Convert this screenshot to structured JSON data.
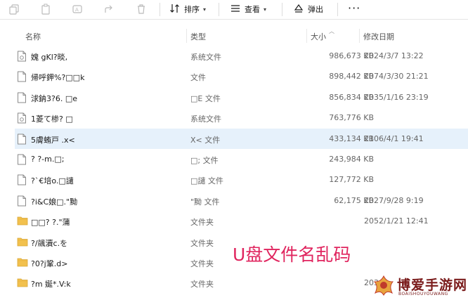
{
  "toolbar": {
    "sort_label": "排序",
    "view_label": "查看",
    "eject_label": "弹出",
    "more_label": "···"
  },
  "columns": {
    "name": "名称",
    "type": "类型",
    "size": "大小",
    "date": "修改日期"
  },
  "rows": [
    {
      "kind": "file",
      "name": "媿  gKl?晱,",
      "type": "系统文件",
      "size": "986,673 KB",
      "date": "2024/3/7 13:22"
    },
    {
      "kind": "file",
      "name": "帰呼鉀%?□□k",
      "type": "文件",
      "size": "898,442 KB",
      "date": "2074/3/30 21:21"
    },
    {
      "kind": "file",
      "name": "浗鈉3?6. □e",
      "type": "□E 文件",
      "size": "856,834 KB",
      "date": "2035/1/16 23:19"
    },
    {
      "kind": "file",
      "name": "1菱て椮?   □",
      "type": "系统文件",
      "size": "763,776 KB",
      "date": ""
    },
    {
      "kind": "file",
      "name": "5膚蛕戸 .x<",
      "type": "X< 文件",
      "size": "433,134 KB",
      "date": "2106/4/1 19:41",
      "selected": true
    },
    {
      "kind": "file",
      "name": "?   ?-m.□;",
      "type": "□; 文件",
      "size": "243,984 KB",
      "date": ""
    },
    {
      "kind": "file",
      "name": " ?`€培o.□譴",
      "type": "□譴 文件",
      "size": "127,772 KB",
      "date": ""
    },
    {
      "kind": "file",
      "name": "?i&C娘□.\"黝",
      "type": "\"黝 文件",
      "size": "62,175 KB",
      "date": "2027/9/28 9:19"
    },
    {
      "kind": "folder",
      "name": "□□?   ?.\"蒲",
      "type": "文件夹",
      "size": "",
      "date": "2052/1/21 12:41"
    },
    {
      "kind": "folder",
      "name": "?/飊瀆c.を",
      "type": "文件夹",
      "size": "",
      "date": ""
    },
    {
      "kind": "folder",
      "name": "?0?j鞏.d>",
      "type": "文件夹",
      "size": "",
      "date": ""
    },
    {
      "kind": "folder",
      "name": "?m   娫*.V:k",
      "type": "文件夹",
      "size": "",
      "date": "203"
    }
  ],
  "overlay_text": "U盘文件名乱码",
  "watermark": {
    "title": "博爱手游网",
    "subtitle": "BOAISHOUYOUWANG"
  },
  "colors": {
    "selected_row": "#e6f1fb",
    "overlay_text": "#e0245e",
    "folder": "#f2c14e",
    "watermark": "#7a1b1b"
  }
}
